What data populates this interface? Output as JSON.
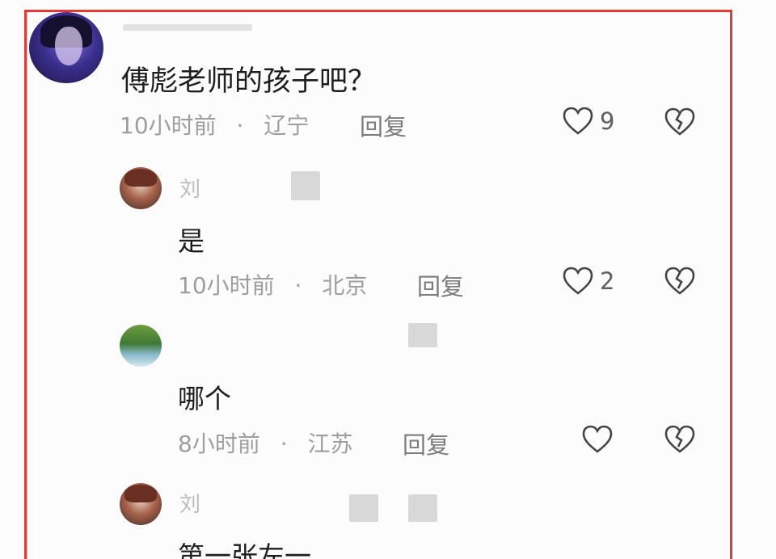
{
  "comments": [
    {
      "text": "傅彪老师的孩子吧？",
      "time": "10小时前",
      "location": "辽宁",
      "reply_label": "回复",
      "likes": "9"
    },
    {
      "name_fragment": "刘",
      "text": "是",
      "time": "10小时前",
      "location": "北京",
      "reply_label": "回复",
      "likes": "2"
    },
    {
      "text": "哪个",
      "time": "8小时前",
      "location": "江苏",
      "reply_label": "回复",
      "likes": ""
    },
    {
      "name_fragment": "刘",
      "text": "第一张左一"
    }
  ],
  "separator": "·",
  "icons": {
    "like": "heart-outline-icon",
    "dislike": "broken-heart-icon"
  },
  "colors": {
    "frame": "#e53935",
    "meta_text": "#9e9e9e",
    "body_text": "#1e1e1e"
  }
}
